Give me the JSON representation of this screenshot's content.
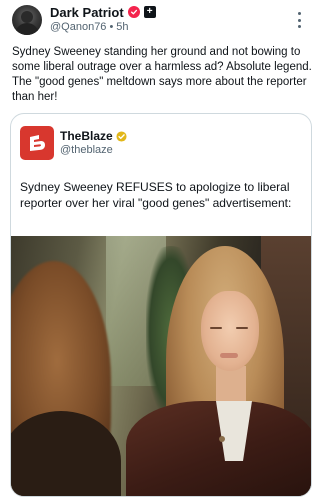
{
  "post": {
    "author_name": "Dark Patriot",
    "handle": "@Qanon76",
    "separator": "•",
    "time": "5h",
    "text": "Sydney Sweeney standing her ground and not bowing to some liberal outrage over a harmless ad? Absolute legend. The \"good genes\" meltdown says more about the reporter than her!",
    "icons": {
      "avatar": "avatar",
      "verified": "verified-badge-icon",
      "subscribe": "plus-icon",
      "more": "more-options-icon"
    },
    "colors": {
      "verified_badge": "#f4244d",
      "handle_text": "#536471"
    }
  },
  "quote": {
    "author_name": "TheBlaze",
    "handle": "@theblaze",
    "text": "Sydney Sweeney REFUSES to apologize to liberal reporter over her viral \"good genes\" advertisement:",
    "icons": {
      "logo": "theblaze-logo",
      "verified": "gold-verified-check-icon"
    },
    "colors": {
      "logo_bg": "#d8372e",
      "gold_check": "#e2b719",
      "border": "#cfd9de"
    }
  }
}
